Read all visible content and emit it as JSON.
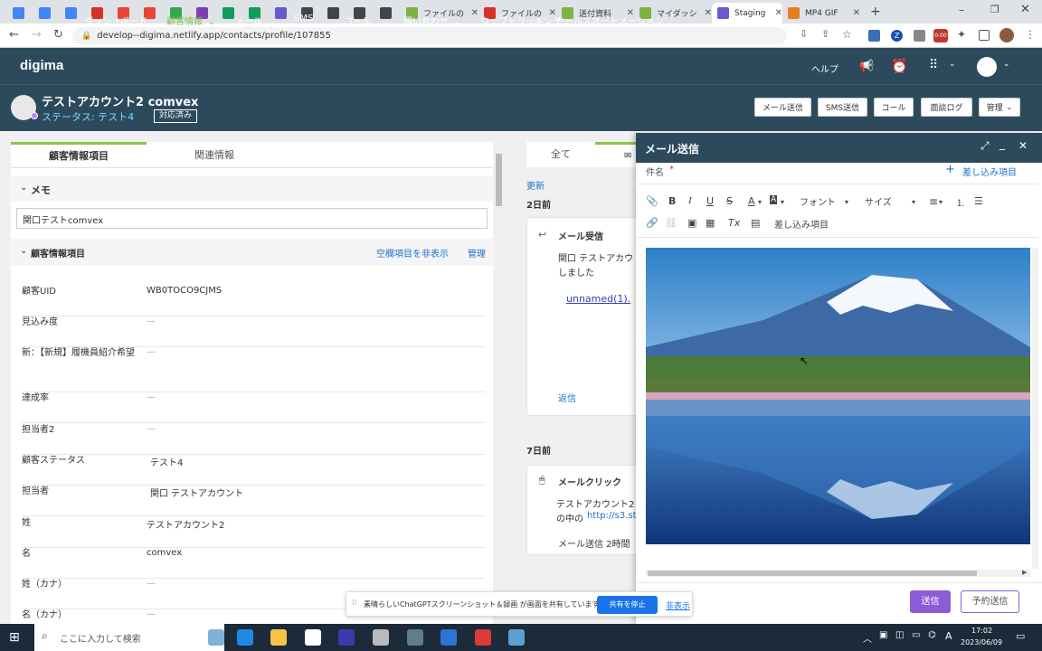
{
  "browser": {
    "tabs": [
      {
        "label": "",
        "icon": "docs-icon",
        "color": "#4285f4"
      },
      {
        "label": "",
        "icon": "docs-icon",
        "color": "#4285f4"
      },
      {
        "label": "",
        "icon": "docs-icon",
        "color": "#4285f4"
      },
      {
        "label": "",
        "icon": "app-icon",
        "color": "#d93025"
      },
      {
        "label": "",
        "icon": "gmail-icon",
        "color": "#ea4335"
      },
      {
        "label": "",
        "icon": "gmail-icon",
        "color": "#ea4335"
      },
      {
        "label": "",
        "icon": "drive-icon",
        "color": "#34a853"
      },
      {
        "label": "",
        "icon": "app-icon",
        "color": "#7b3fb5"
      },
      {
        "label": "",
        "icon": "sheets-icon",
        "color": "#0f9d58"
      },
      {
        "label": "",
        "icon": "sheets-icon",
        "color": "#0f9d58"
      },
      {
        "label": "",
        "icon": "digima-icon",
        "color": "#6a5acd"
      },
      {
        "label": "",
        "icon": "app-icon",
        "color": "#444"
      },
      {
        "label": "",
        "icon": "app-icon",
        "color": "#444"
      },
      {
        "label": "",
        "icon": "app-icon",
        "color": "#444"
      },
      {
        "label": "",
        "icon": "app-icon",
        "color": "#444"
      },
      {
        "label": "ファイルの",
        "icon": "digima-icon",
        "color": "#7cb342"
      },
      {
        "label": "ファイルの",
        "icon": "warning-icon",
        "color": "#d93025"
      },
      {
        "label": "送付資料",
        "icon": "digima-icon",
        "color": "#7cb342"
      },
      {
        "label": "マイダッシ",
        "icon": "digima-icon",
        "color": "#7cb342"
      },
      {
        "label": "Staging",
        "icon": "digima-icon",
        "color": "#6a5acd"
      },
      {
        "label": "MP4 GIF",
        "icon": "app-icon",
        "color": "#e67e22"
      }
    ],
    "url": "develop--digima.netlify.app/contacts/profile/107855"
  },
  "appnav": {
    "logo": "digima",
    "items": [
      "ダッシュボード",
      "顧客情報",
      "メール",
      "SMS",
      "コール",
      "問い合わせ",
      "ウェブトラッキング",
      "セールスオートメーション"
    ],
    "active": "顧客情報",
    "help": "ヘルプ"
  },
  "contact": {
    "name": "テストアカウント2 comvex",
    "status": "ステータス: テスト4",
    "badge": "対応済み",
    "buttons": [
      "メール送信",
      "SMS送信",
      "コール",
      "面談ログ",
      "管理"
    ]
  },
  "left": {
    "tabs": [
      "顧客情報項目",
      "関連情報"
    ],
    "memo_title": "メモ",
    "memo_value": "関口テストcomvex",
    "section_title": "顧客情報項目",
    "hide_empty": "空欄項目を非表示",
    "manage": "管理",
    "fields": [
      {
        "label": "顧客UID",
        "value": "WB0TOCO9CJMS"
      },
      {
        "label": "見込み度",
        "value": "—"
      },
      {
        "label": "新：【新規】履機員紹介希望",
        "value": "—"
      },
      {
        "label": "達成率",
        "value": "—"
      },
      {
        "label": "担当者2",
        "value": "—"
      },
      {
        "label": "顧客ステータス",
        "value": "テスト4"
      },
      {
        "label": "担当者",
        "value": "関口 テストアカウント"
      },
      {
        "label": "姓",
        "value": "テストアカウント2"
      },
      {
        "label": "名",
        "value": "comvex"
      },
      {
        "label": "姓（カナ）",
        "value": "—"
      },
      {
        "label": "名（カナ）",
        "value": "—"
      }
    ]
  },
  "mid": {
    "tab_all": "全て",
    "update": "更新",
    "day1": "2日前",
    "event1_title": "メール受信",
    "event1_body": "関口 テストアカウ",
    "event1_body2": "しました",
    "event1_link": "unnamed(1).",
    "event1_reply": "返信",
    "day2": "7日前",
    "event2_title": "メールクリック",
    "event2_body": "テストアカウント2",
    "event2_body2": "の中の",
    "event2_link": "http://s3.sta",
    "event2_footer": "メール送信 2時間"
  },
  "modal": {
    "title": "メール送信",
    "subject_label": "件名",
    "required": "*",
    "insert_item": "差し込み項目",
    "font_label": "フォント",
    "size_label": "サイズ",
    "insert_item2": "差し込み項目",
    "send": "送信",
    "schedule": "予約送信"
  },
  "share": {
    "text": "素晴らしいChatGPTスクリーンショット＆録画 が画面を共有しています。",
    "stop": "共有を停止",
    "hide": "非表示"
  },
  "taskbar": {
    "search": "ここに入力して検索",
    "time": "17:02",
    "date": "2023/06/09",
    "ime": "A"
  }
}
